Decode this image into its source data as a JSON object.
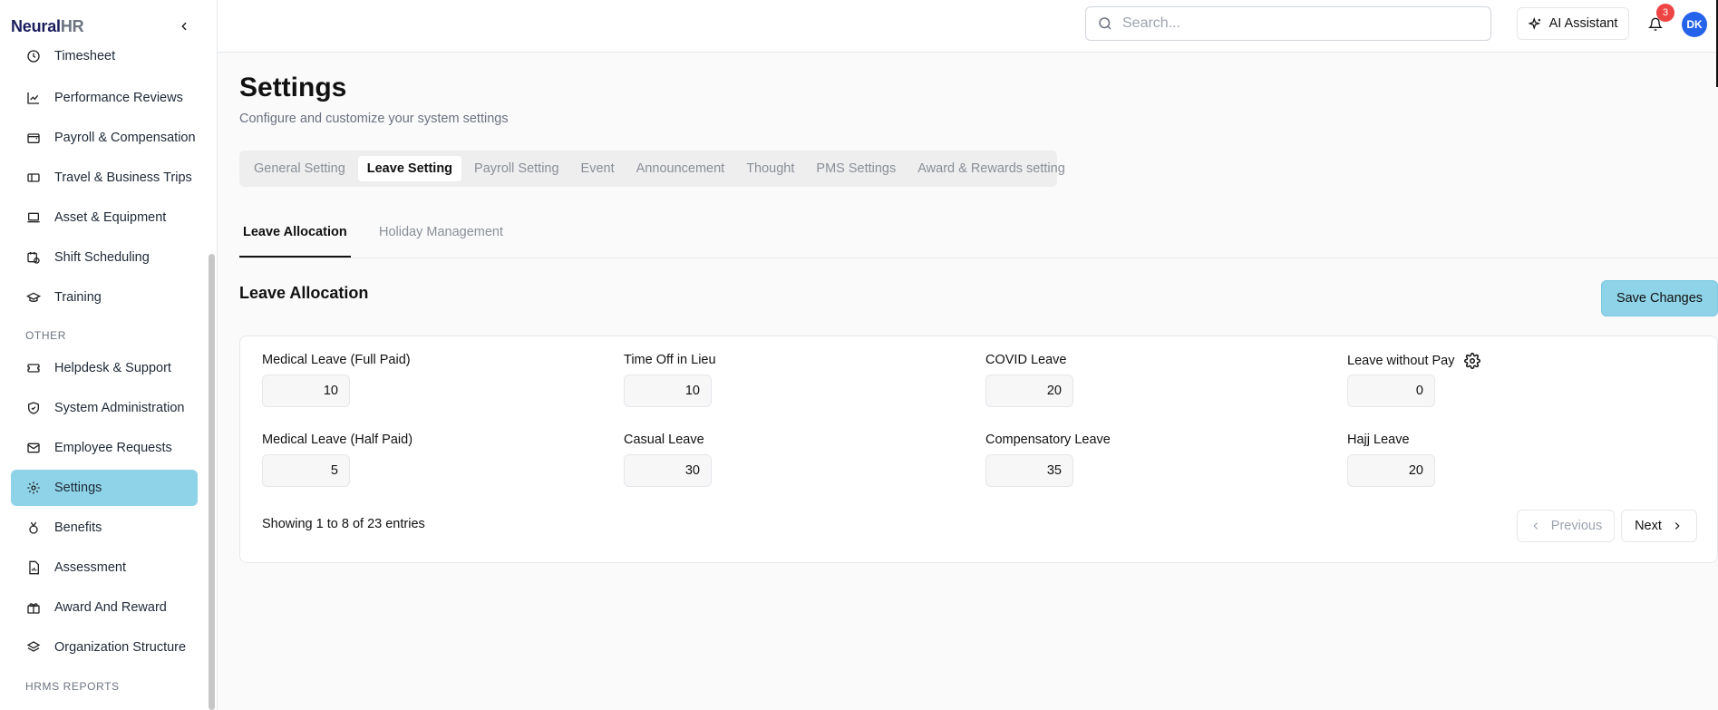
{
  "app": {
    "logo_part1": "Neural",
    "logo_part2": "HR"
  },
  "sidebar": {
    "items": [
      {
        "label": "Timesheet",
        "icon": "clock-icon"
      },
      {
        "label": "Performance Reviews",
        "icon": "chart-icon"
      },
      {
        "label": "Payroll & Compensation",
        "icon": "wallet-icon"
      },
      {
        "label": "Travel & Business Trips",
        "icon": "ticket-icon"
      },
      {
        "label": "Asset & Equipment",
        "icon": "laptop-icon"
      },
      {
        "label": "Shift Scheduling",
        "icon": "calendar-clock-icon"
      },
      {
        "label": "Training",
        "icon": "graduation-cap-icon"
      },
      {
        "label": "Helpdesk & Support",
        "icon": "ticket-icon"
      },
      {
        "label": "System Administration",
        "icon": "shield-icon"
      },
      {
        "label": "Employee Requests",
        "icon": "mail-icon"
      },
      {
        "label": "Settings",
        "icon": "gear-icon"
      },
      {
        "label": "Benefits",
        "icon": "medal-icon"
      },
      {
        "label": "Assessment",
        "icon": "file-chart-icon"
      },
      {
        "label": "Award And Reward",
        "icon": "gift-icon"
      },
      {
        "label": "Organization Structure",
        "icon": "layers-icon"
      }
    ],
    "sections": {
      "other": "OTHER",
      "hrms_reports": "HRMS REPORTS"
    },
    "active_item": "Settings"
  },
  "topbar": {
    "search_placeholder": "Search...",
    "ai_label": "AI Assistant",
    "notification_count": "3",
    "avatar_initials": "DK"
  },
  "page": {
    "title": "Settings",
    "subtitle": "Configure and customize your system settings",
    "tabs": [
      "General Setting",
      "Leave Setting",
      "Payroll Setting",
      "Event",
      "Announcement",
      "Thought",
      "PMS Settings",
      "Award & Rewards setting"
    ],
    "active_tab": "Leave Setting",
    "subtabs": [
      "Leave Allocation",
      "Holiday Management"
    ],
    "active_subtab": "Leave Allocation",
    "section_title": "Leave Allocation",
    "save_label": "Save Changes"
  },
  "leaves": [
    {
      "label": "Medical Leave (Full Paid)",
      "value": "10"
    },
    {
      "label": "Time Off in Lieu",
      "value": "10"
    },
    {
      "label": "COVID Leave",
      "value": "20"
    },
    {
      "label": "Leave without Pay",
      "value": "0"
    },
    {
      "label": "Medical Leave (Half Paid)",
      "value": "5"
    },
    {
      "label": "Casual Leave",
      "value": "30"
    },
    {
      "label": "Compensatory Leave",
      "value": "35"
    },
    {
      "label": "Hajj Leave",
      "value": "20"
    }
  ],
  "pagination": {
    "info": "Showing 1 to 8 of 23 entries",
    "prev": "Previous",
    "next": "Next"
  },
  "colors": {
    "accent": "#8fd3e8",
    "badge": "#ef4444",
    "avatar": "#2563eb"
  }
}
